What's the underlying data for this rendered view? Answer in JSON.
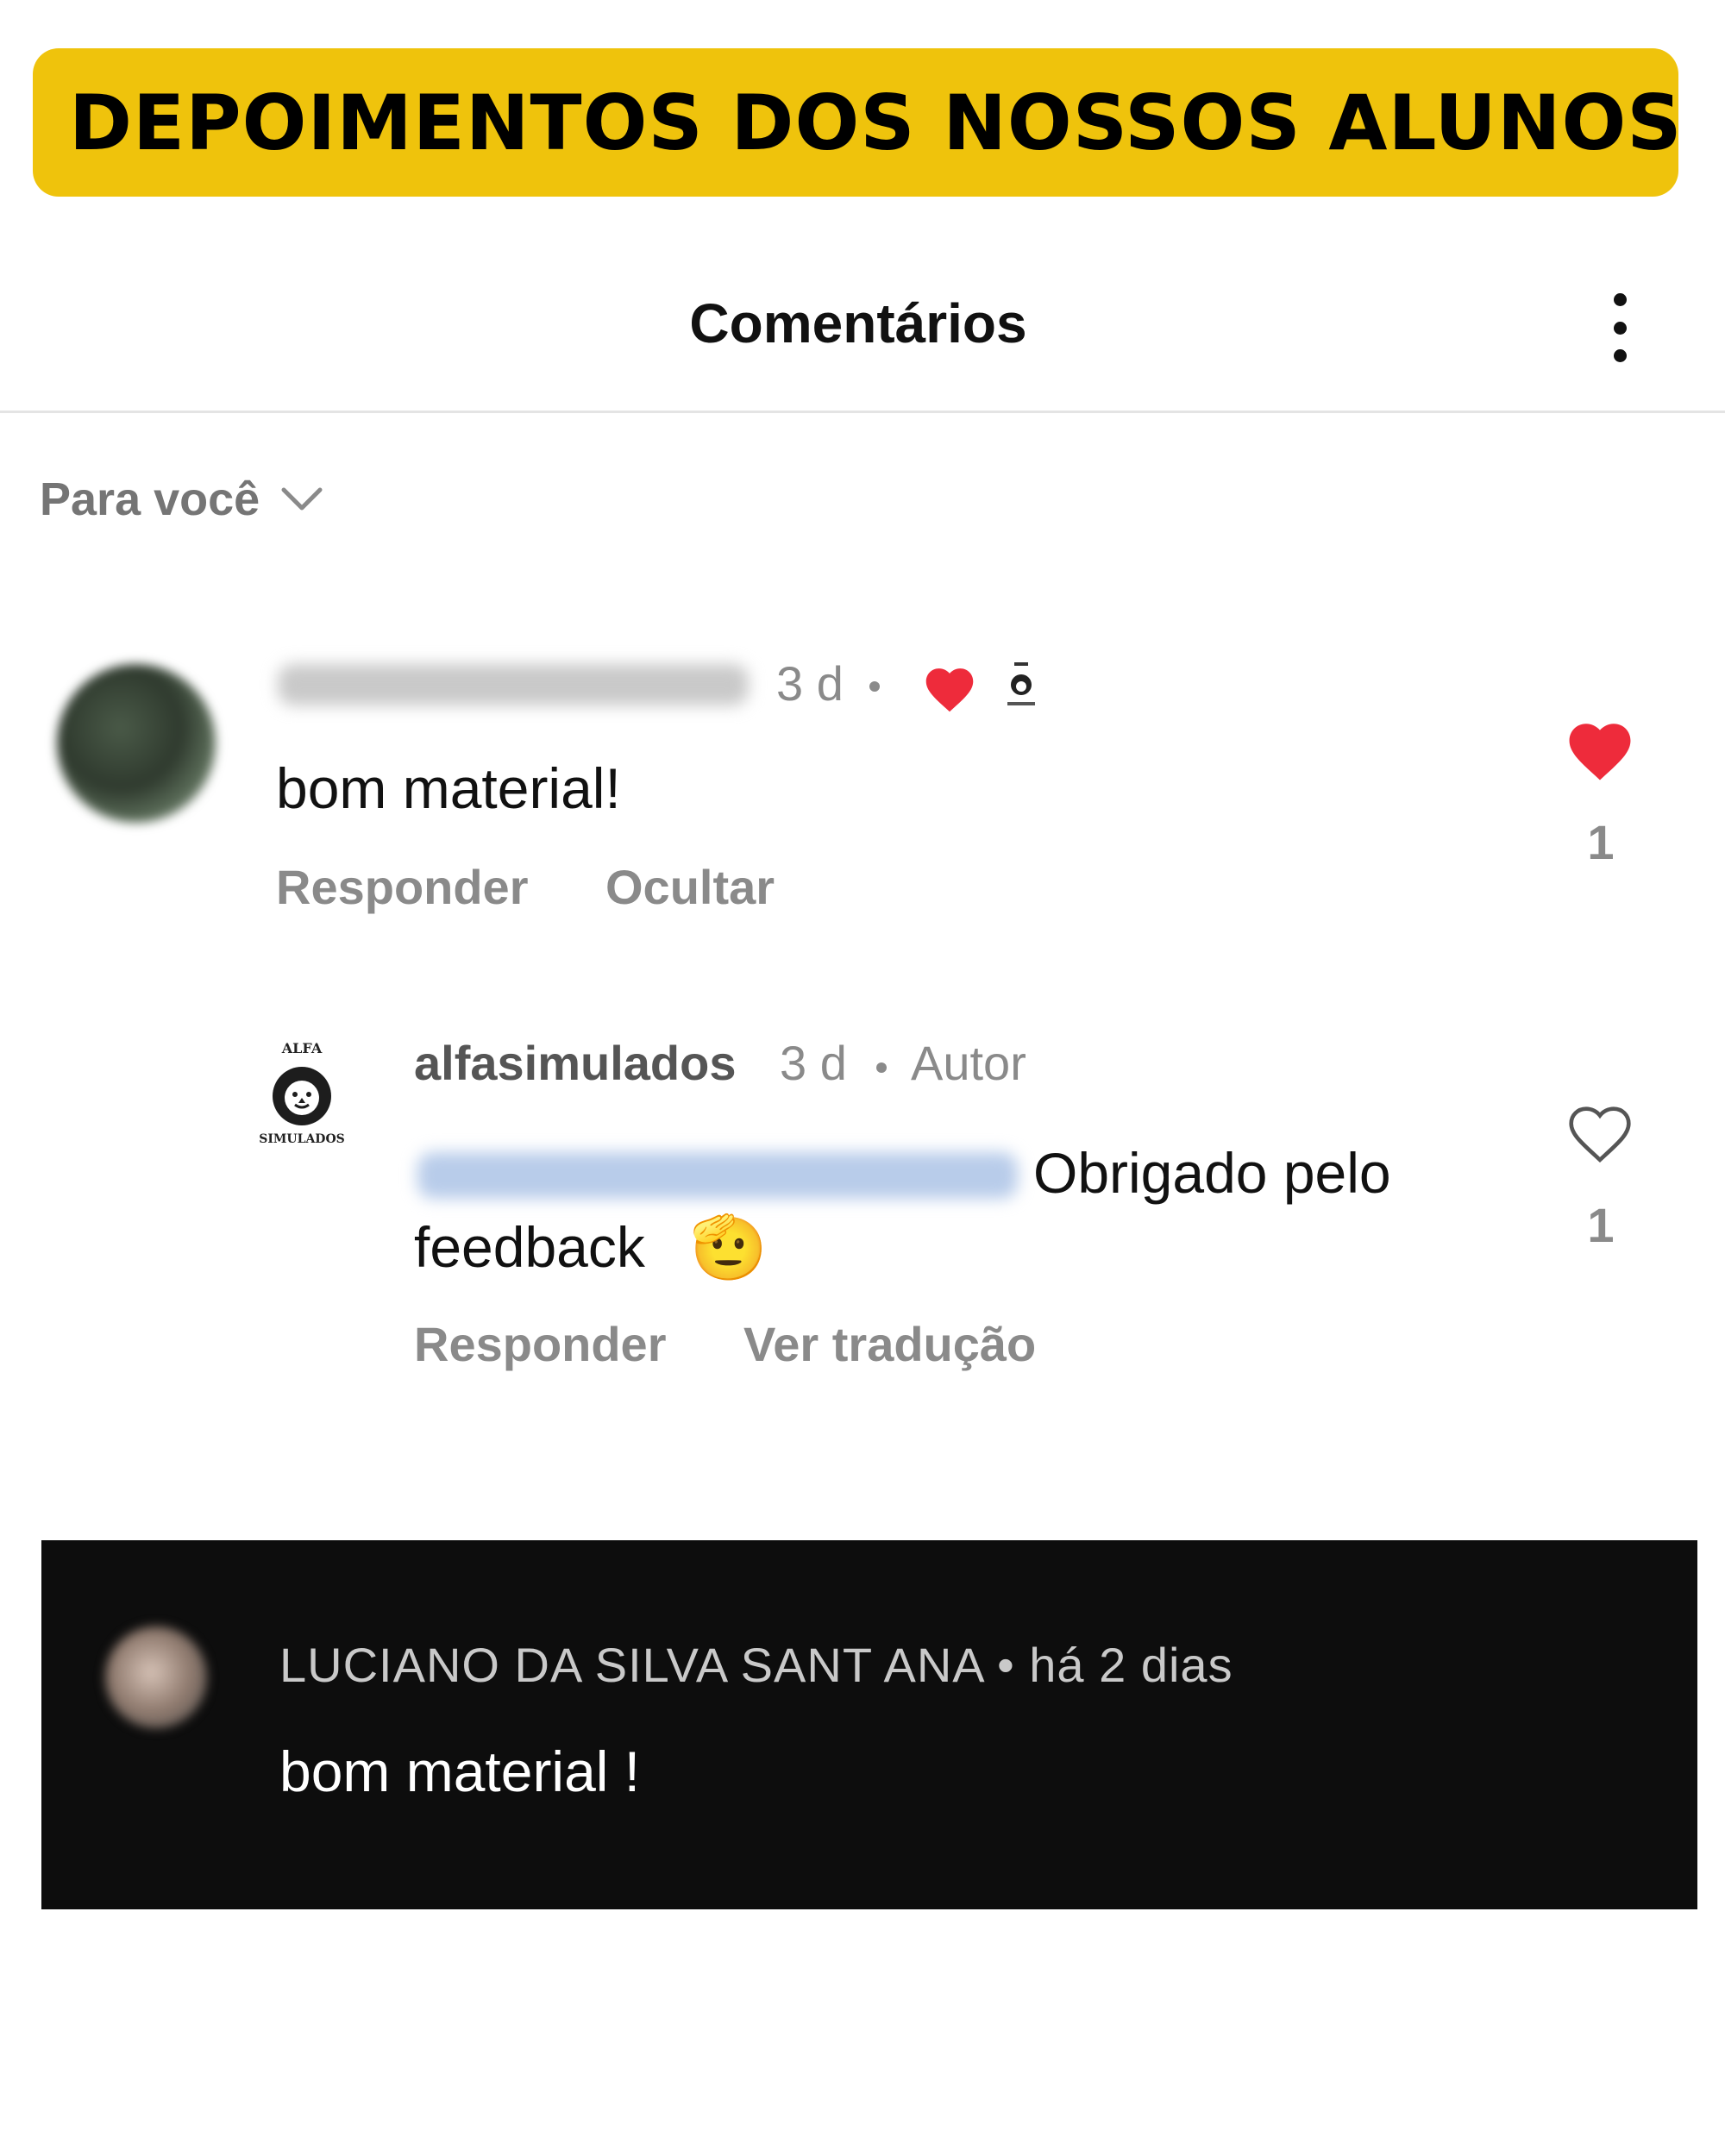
{
  "banner": {
    "title": "DEPOIMENTOS DOS NOSSOS ALUNOS"
  },
  "header": {
    "title": "Comentários"
  },
  "filter": {
    "label": "Para você"
  },
  "comment1": {
    "username": "sahadw23sahadw23",
    "time": "3 d",
    "text": "bom material!",
    "actions": [
      "Responder",
      "Ocultar"
    ],
    "likes": "1",
    "liked": true
  },
  "reply": {
    "username": "alfasimulados",
    "time": "3 d",
    "role": "Autor",
    "mention": "@sahadw23sahadw23",
    "text_line1": "Obrigado pelo",
    "text_line2": "feedback",
    "emoji": "🫡",
    "actions": [
      "Responder",
      "Ver tradução"
    ],
    "likes": "1",
    "liked": false,
    "avatar": {
      "top": "ALFA",
      "bottom": "SIMULADOS"
    }
  },
  "comment2": {
    "author": "LUCIANO DA SILVA SANT ANA",
    "time": "há 2 dias",
    "text": "bom material !"
  },
  "colors": {
    "banner": "#EFC30C",
    "heart": "#EE2B3B",
    "muted": "#8A8A8A",
    "dark_panel": "#0D0D0D"
  },
  "icons": [
    "kebab-icon",
    "chevron-down-icon",
    "heart-filled-icon",
    "heart-outline-icon",
    "lion-logo-icon"
  ]
}
